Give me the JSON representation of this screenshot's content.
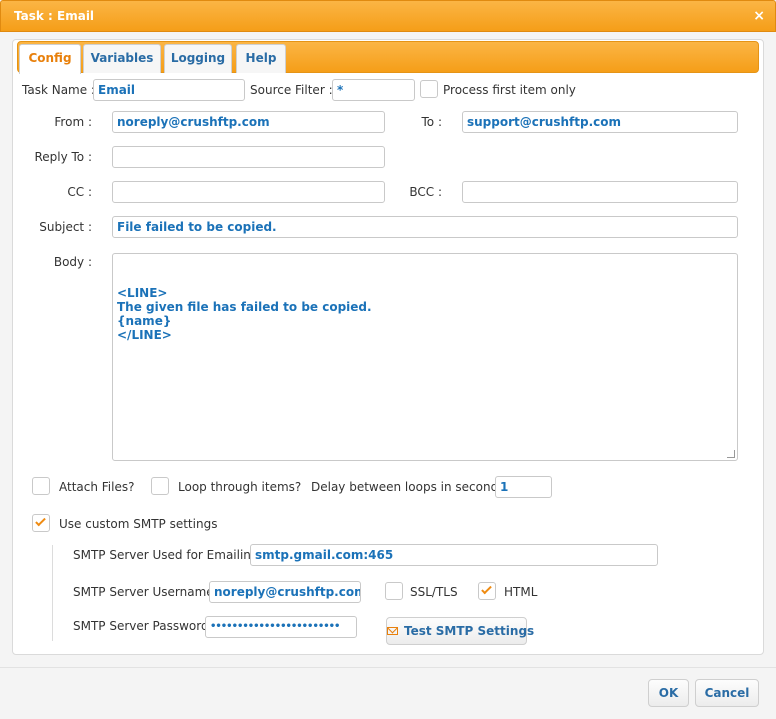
{
  "window": {
    "title": "Task : Email",
    "close_symbol": "×"
  },
  "tabs": [
    {
      "label": "Config",
      "active": true
    },
    {
      "label": "Variables",
      "active": false
    },
    {
      "label": "Logging",
      "active": false
    },
    {
      "label": "Help",
      "active": false
    }
  ],
  "form": {
    "task_name_label": "Task Name :",
    "task_name_value": "Email",
    "source_filter_label": "Source Filter :",
    "source_filter_value": "*",
    "process_first_label": "Process first item only",
    "process_first_checked": false,
    "from_label": "From :",
    "from_value": "noreply@crushftp.com",
    "to_label": "To :",
    "to_value": "support@crushftp.com",
    "reply_to_label": "Reply To :",
    "reply_to_value": "",
    "cc_label": "CC :",
    "cc_value": "",
    "bcc_label": "BCC :",
    "bcc_value": "",
    "subject_label": "Subject :",
    "subject_value": "File failed to be copied.",
    "body_label": "Body :",
    "body_value": "<LINE>\nThe given file has failed to be copied.\n{name}\n</LINE>",
    "attach_files_label": "Attach Files?",
    "attach_files_checked": false,
    "loop_items_label": "Loop through items?",
    "loop_items_checked": false,
    "delay_label": "Delay between loops in seconds :",
    "delay_value": "1",
    "custom_smtp_label": "Use custom SMTP settings",
    "custom_smtp_checked": true
  },
  "smtp": {
    "server_label": "SMTP Server Used for Emailing :",
    "server_value": "smtp.gmail.com:465",
    "username_label": "SMTP Server Username :",
    "username_value": "noreply@crushftp.com",
    "ssl_label": "SSL/TLS",
    "ssl_checked": false,
    "html_label": "HTML",
    "html_checked": true,
    "password_label": "SMTP Server Password :",
    "password_value": "••••••••••••••••••••••••",
    "test_button_label": "Test SMTP Settings"
  },
  "footer": {
    "ok_label": "OK",
    "cancel_label": "Cancel"
  },
  "colors": {
    "accent": "#f59e18",
    "link": "#2a6ca5",
    "value": "#1b72b8",
    "check": "#ef8b12"
  }
}
